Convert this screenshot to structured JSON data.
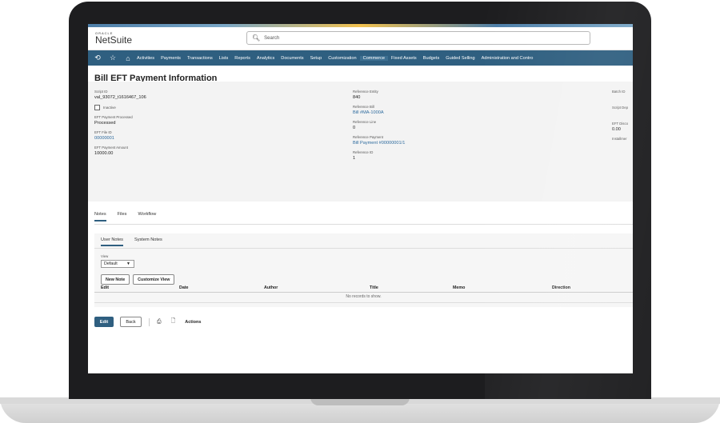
{
  "header": {
    "logo_small": "ORACLE",
    "logo_big": "NetSuite",
    "search_placeholder": "Search"
  },
  "nav": {
    "items": [
      "Activities",
      "Payments",
      "Transactions",
      "Lists",
      "Reports",
      "Analytics",
      "Documents",
      "Setup",
      "Customization",
      "Commerce",
      "Fixed Assets",
      "Budgets",
      "Guided Selling",
      "Administration and Contro"
    ]
  },
  "page": {
    "title": "Bill EFT Payment Information"
  },
  "toolbar": {
    "edit": "Edit",
    "back": "Back",
    "actions": "Actions"
  },
  "fields": {
    "script_id_label": "Script ID",
    "script_id_value": "val_93072_t1616467_106",
    "inactive_label": "Inactive",
    "eft_processed_label": "EFT Payment Processed",
    "eft_processed_value": "Processed",
    "eft_file_id_label": "EFT File ID",
    "eft_file_id_value": "00000001",
    "eft_amount_label": "EFT Payment Amount",
    "eft_amount_value": "10000.00",
    "ref_entity_label": "Reference Entity",
    "ref_entity_value": "840",
    "ref_bill_label": "Reference Bill",
    "ref_bill_value": "Bill #MA-1000A",
    "ref_line_label": "Reference Line",
    "ref_line_value": "0",
    "ref_payment_label": "Reference Payment",
    "ref_payment_value": "Bill Payment #00000001/1",
    "ref_id_label": "Reference ID",
    "ref_id_value": "1",
    "batch_id_label": "Batch ID",
    "script_dep_label": "Script Dep",
    "eft_disco_label": "EFT Disco",
    "eft_disco_value": "0.00",
    "installment_label": "Installmer"
  },
  "tabs": {
    "notes": "Notes",
    "files": "Files",
    "workflow": "Workflow"
  },
  "subtabs": {
    "user_notes": "User Notes",
    "system_notes": "System Notes"
  },
  "view": {
    "label": "View",
    "selected": "Default"
  },
  "notes_buttons": {
    "new_note": "New Note",
    "customize_view": "Customize View"
  },
  "table": {
    "columns": [
      "Edit",
      "Date",
      "Author",
      "Title",
      "Memo",
      "Direction"
    ],
    "empty_text": "No records to show."
  },
  "colors": {
    "nav_bg": "#2f5f80",
    "primary_button": "#2f5f80",
    "link": "#2e6b9e"
  },
  "icons": [
    "history-icon",
    "star-icon",
    "home-icon",
    "search-icon",
    "print-icon",
    "document-icon",
    "dropdown-caret-icon"
  ]
}
